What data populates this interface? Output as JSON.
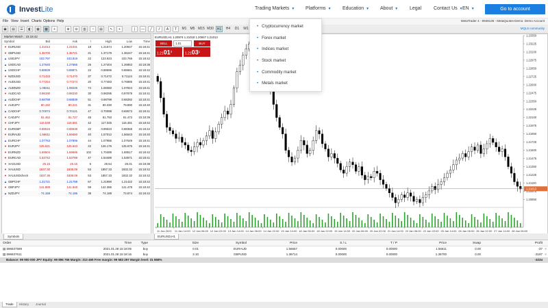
{
  "site": {
    "logo_text": "Invest",
    "logo_accent": "Lite",
    "nav": [
      {
        "label": "Trading Markets",
        "caret": true
      },
      {
        "label": "Platforms",
        "caret": true
      },
      {
        "label": "Education",
        "caret": true
      },
      {
        "label": "About",
        "caret": true
      },
      {
        "label": "Legal",
        "caret": false
      },
      {
        "label": "Contact Us",
        "caret": true
      },
      {
        "label": "EN",
        "caret": true
      }
    ],
    "cta": "Go to account",
    "dropdown": [
      "Cryptocurrency market",
      "Forex market",
      "Indices market",
      "Stock market",
      "Commodity market",
      "Metals market"
    ]
  },
  "terminal": {
    "menu": [
      "File",
      "View",
      "Insert",
      "Charts",
      "Options",
      "Help"
    ],
    "window_title": "MetaTrader 4 - 8948136 - MetaQuotes-Demo: Demo Account",
    "timeframes": [
      "M1",
      "M5",
      "M15",
      "M30",
      "H1",
      "H4",
      "D1",
      "W1",
      "MN"
    ],
    "active_timeframe": "H1",
    "mql_link": "MQL5 community",
    "market_watch": {
      "title": "Market Watch : 15:18:42",
      "columns": {
        "symbol": "Symbol",
        "bid": "Bid",
        "ask": "Ask",
        "spread": "!",
        "high": "High",
        "low": "Low",
        "time": "Time"
      },
      "rows": [
        {
          "sym": "EURUSD",
          "bid": "1.21013",
          "ask": "1.21031",
          "sp": "18",
          "hi": "1.21674",
          "lo": "1.20947",
          "tm": "15:18:41",
          "dir": "dn"
        },
        {
          "sym": "GBPUSD",
          "bid": "1.36700",
          "ask": "1.36721",
          "sp": "21",
          "hi": "1.37179",
          "lo": "1.36247",
          "tm": "15:18:41",
          "dir": "dn"
        },
        {
          "sym": "USDJPY",
          "bid": "103.797",
          "ask": "103.819",
          "sp": "22",
          "hi": "123.923",
          "lo": "103.765",
          "tm": "15:18:42",
          "dir": "up"
        },
        {
          "sym": "USDCAD",
          "bid": "1.27640",
          "ask": "1.27666",
          "sp": "26",
          "hi": "1.27404",
          "lo": "1.26853",
          "tm": "15:18:38",
          "dir": "up"
        },
        {
          "sym": "USDCHF",
          "bid": "0.88839",
          "ask": "0.89871",
          "sp": "22",
          "hi": "0.88696",
          "lo": "0.88661",
          "tm": "15:18:42",
          "dir": "up"
        },
        {
          "sym": "NZDUSD",
          "bid": "0.71433",
          "ask": "0.71470",
          "sp": "37",
          "hi": "0.71472",
          "lo": "0.71124",
          "tm": "15:18:41",
          "dir": "dn"
        },
        {
          "sym": "AUDUSD",
          "bid": "0.77254",
          "ask": "0.77274",
          "sp": "20",
          "hi": "0.77483",
          "lo": "0.76885",
          "tm": "15:18:41",
          "dir": "dn"
        },
        {
          "sym": "AUDNZD",
          "bid": "1.08211",
          "ask": "1.08225",
          "sp": "74",
          "hi": "1.08360",
          "lo": "1.07924",
          "tm": "15:18:41",
          "dir": "up"
        },
        {
          "sym": "AUDCAD",
          "bid": "0.98190",
          "ask": "0.98330",
          "sp": "30",
          "hi": "0.98295",
          "lo": "0.97879",
          "tm": "15:18:41",
          "dir": "dn"
        },
        {
          "sym": "AUDCHF",
          "bid": "0.68788",
          "ask": "0.68839",
          "sp": "51",
          "hi": "0.68799",
          "lo": "0.68282",
          "tm": "15:18:41",
          "dir": "up"
        },
        {
          "sym": "AUDJPY",
          "bid": "80.192",
          "ask": "80.221",
          "sp": "31",
          "hi": "80.330",
          "lo": "79.890",
          "tm": "15:18:40",
          "dir": "dn"
        },
        {
          "sym": "CADCHF",
          "bid": "0.70074",
          "ask": "0.70121",
          "sp": "47",
          "hi": "0.70098",
          "lo": "0.69573",
          "tm": "15:18:41",
          "dir": "up"
        },
        {
          "sym": "CADJPY",
          "bid": "81.462",
          "ask": "81.727",
          "sp": "45",
          "hi": "81.793",
          "lo": "81.473",
          "tm": "15:18:39",
          "dir": "dn"
        },
        {
          "sym": "CHFJPY",
          "bid": "116.539",
          "ask": "116.581",
          "sp": "42",
          "hi": "117.025",
          "lo": "116.451",
          "tm": "15:18:42",
          "dir": "dn"
        },
        {
          "sym": "EURGBP",
          "bid": "0.88515",
          "ask": "0.88538",
          "sp": "22",
          "hi": "0.89023",
          "lo": "0.88368",
          "tm": "15:18:42",
          "dir": "dn"
        },
        {
          "sym": "EURAUD",
          "bid": "1.56611",
          "ask": "1.56650",
          "sp": "40",
          "hi": "1.57012",
          "lo": "1.56543",
          "tm": "15:18:40",
          "dir": "dn"
        },
        {
          "sym": "EURCHF",
          "bid": "1.07763",
          "ask": "1.07806",
          "sp": "44",
          "hi": "1.07986",
          "lo": "1.07649",
          "tm": "15:18:41",
          "dir": "up"
        },
        {
          "sym": "EURJPY",
          "bid": "125.621",
          "ask": "125.643",
          "sp": "22",
          "hi": "126.176",
          "lo": "125.575",
          "tm": "15:18:41",
          "dir": "dn"
        },
        {
          "sym": "EURNZD",
          "bid": "1.69504",
          "ask": "1.69606",
          "sp": "102",
          "hi": "1.70489",
          "lo": "1.69517",
          "tm": "15:18:42",
          "dir": "dn"
        },
        {
          "sym": "EURCAD",
          "bid": "1.53742",
          "ask": "1.53789",
          "sp": "47",
          "hi": "1.54489",
          "lo": "1.53671",
          "tm": "15:18:41",
          "dir": "dn"
        },
        {
          "sym": "XAGUSD",
          "bid": "25.15",
          "ask": "25.16",
          "sp": "5",
          "hi": "25.54",
          "lo": "25.01",
          "tm": "15:18:38",
          "dir": "dn"
        },
        {
          "sym": "XAUUSD",
          "bid": "1837.30",
          "ask": "1838.09",
          "sp": "53",
          "hi": "1857.33",
          "lo": "1832.32",
          "tm": "15:18:42",
          "dir": "dn"
        },
        {
          "sym": "XAUUSDcheck",
          "bid": "1837.36",
          "ask": "1838.09",
          "sp": "53",
          "hi": "1857.33",
          "lo": "1832.32",
          "tm": "15:18:42",
          "dir": "dn"
        },
        {
          "sym": "GBPCHF",
          "bid": "1.21721",
          "ask": "1.21788",
          "sp": "67",
          "hi": "1.21990",
          "lo": "1.21422",
          "tm": "15:18:42",
          "dir": "up"
        },
        {
          "sym": "GBPJPY",
          "bid": "141.889",
          "ask": "141.948",
          "sp": "59",
          "hi": "142.386",
          "lo": "141.478",
          "tm": "15:18:42",
          "dir": "dn"
        },
        {
          "sym": "NZDJPY",
          "bid": "74.158",
          "ask": "74.196",
          "sp": "38",
          "hi": "74.189",
          "lo": "73.874",
          "tm": "15:18:42",
          "dir": "up"
        }
      ],
      "tab": "Symbols"
    },
    "chart": {
      "caption": "EURUSD,H1  1.20974 1.21018 1.20947 1.21013",
      "sell_label": "SELL",
      "buy_label": "BUY",
      "lot": "1.01",
      "sell_price_prefix": "1.21",
      "sell_price_big": "01",
      "sell_price_sup": "3",
      "buy_price_prefix": "1.21",
      "buy_price_big": "03",
      "buy_price_sup": "1",
      "current_price": "1.21013",
      "tab": "EURUSD,H1"
    },
    "trade_panel": {
      "columns": [
        "Order",
        "Time",
        "Type",
        "Size",
        "Symbol",
        "Price",
        "S / L",
        "T / P",
        "Price",
        "Swap",
        "Profit"
      ],
      "rows": [
        {
          "order": "696837589",
          "time": "2021.01.28 15:18:05",
          "type": "buy",
          "size": "0.01",
          "symbol": "EURAUD",
          "price": "1.56657",
          "sl": "0.00000",
          "tp": "0.00000",
          "cur": "1.56611",
          "swap": "0.00",
          "profit": "-37"
        },
        {
          "order": "696837611",
          "time": "2021.01.28 15:18:16",
          "type": "buy",
          "size": "2.10",
          "symbol": "GBPUSD",
          "price": "1.36714",
          "sl": "0.00000",
          "tp": "0.00000",
          "cur": "1.36700",
          "swap": "0.00",
          "profit": "-3197"
        }
      ],
      "balance": "Balance: 99 900 000 JPY  Equity: 99 896 766  Margin: 313 469  Free margin: 99 583 297  Margin level: 31 868%",
      "balance_total": "-3234",
      "tabs": [
        "Trade",
        "History",
        "Journal"
      ]
    }
  },
  "chart_data": {
    "type": "candlestick",
    "symbol": "EURUSD",
    "timeframe": "H1",
    "ylim": [
      1.2076,
      1.2335
    ],
    "y_ticks": [
      "1.23350",
      "1.23225",
      "1.23100",
      "1.22975",
      "1.22850",
      "1.22725",
      "1.22600",
      "1.22475",
      "1.22350",
      "1.22225",
      "1.22100",
      "1.21975",
      "1.21850",
      "1.21725",
      "1.21600",
      "1.21475",
      "1.21350",
      "1.21225",
      "1.21100",
      "1.20975",
      "1.20850",
      "1.20725"
    ],
    "x_ticks": [
      "11 Jan 2021",
      "11 Jan 14:00",
      "12 Jan 06:00",
      "12 Jan 22:00",
      "13 Jan 14:00",
      "14 Jan 06:00",
      "14 Jan 22:00",
      "15 Jan 14:00",
      "18 Jan 06:00",
      "18 Jan 22:00",
      "19 Jan 14:00",
      "20 Jan 06:00",
      "20 Jan 22:00",
      "21 Jan 14:00",
      "22 Jan 06:00",
      "22 Jan 22:00",
      "25 Jan 14:00",
      "26 Jan 06:00",
      "26 Jan 22:00",
      "27 Jan 14:00",
      "28 Jan 06:00"
    ],
    "closes": [
      1.2265,
      1.224,
      1.2215,
      1.2195,
      1.219,
      1.2185,
      1.2178,
      1.218,
      1.2172,
      1.2168,
      1.216,
      1.2158,
      1.2165,
      1.2172,
      1.2168,
      1.2175,
      1.2182,
      1.219,
      1.2178,
      1.2188,
      1.22,
      1.221,
      1.222,
      1.2215,
      1.223,
      1.2255,
      1.228,
      1.229,
      1.2305,
      1.2315,
      1.2322,
      1.231,
      1.2318,
      1.23,
      1.2285,
      1.2292,
      1.227,
      1.225,
      1.223,
      1.221,
      1.2195,
      1.2185,
      1.216,
      1.215,
      1.2142,
      1.2148,
      1.216,
      1.2175,
      1.2168,
      1.2155,
      1.216,
      1.2175,
      1.219,
      1.2185,
      1.217,
      1.2162,
      1.215,
      1.2155,
      1.2148,
      1.214,
      1.213,
      1.2125,
      1.2135,
      1.2142,
      1.2138,
      1.2128,
      1.2135,
      1.2122,
      1.2115,
      1.212,
      1.2118,
      1.2128,
      1.2125,
      1.2115,
      1.2108,
      1.2102,
      1.2095,
      1.2088,
      1.208,
      1.2085,
      1.2092,
      1.2088,
      1.2095,
      1.209,
      1.2082,
      1.2085,
      1.208,
      1.2088,
      1.2092,
      1.2098,
      1.2105,
      1.21,
      1.2108,
      1.2112,
      1.2118,
      1.2125,
      1.213,
      1.2138,
      1.2145,
      1.2148,
      1.2155,
      1.215,
      1.2158,
      1.2165,
      1.216,
      1.2168,
      1.2155,
      1.2162,
      1.217,
      1.2178,
      1.2172,
      1.2165,
      1.2158,
      1.2162,
      1.215,
      1.2135,
      1.2125,
      1.2112,
      1.2105,
      1.2101
    ]
  }
}
